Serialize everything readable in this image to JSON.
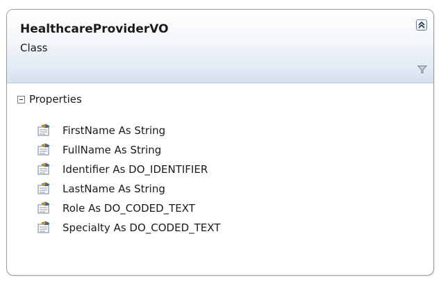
{
  "class_shape": {
    "name": "HealthcareProviderVO",
    "kind": "Class"
  },
  "compartments": [
    {
      "title": "Properties",
      "items": [
        {
          "label": "FirstName As String"
        },
        {
          "label": "FullName As String"
        },
        {
          "label": "Identifier As DO_IDENTIFIER"
        },
        {
          "label": "LastName As String"
        },
        {
          "label": "Role As DO_CODED_TEXT"
        },
        {
          "label": "Specialty As DO_CODED_TEXT"
        }
      ]
    }
  ],
  "icons": {
    "collapse": "double-chevron-up-icon",
    "filter": "filter-icon",
    "expander": "minus-icon",
    "member": "property-icon"
  },
  "colors": {
    "border": "#9a9a9a",
    "header_gradient_top": "#ffffff",
    "header_gradient_bottom": "#d7e2ef",
    "icon_accent": "#2f6db5"
  }
}
